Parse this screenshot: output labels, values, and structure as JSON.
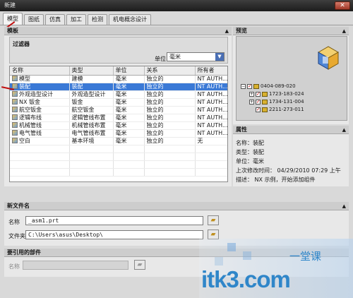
{
  "window": {
    "title": "新建",
    "close_label": "✕"
  },
  "tabs": [
    {
      "label": "模型",
      "active": true
    },
    {
      "label": "图纸",
      "active": false
    },
    {
      "label": "仿真",
      "active": false
    },
    {
      "label": "加工",
      "active": false
    },
    {
      "label": "检测",
      "active": false
    },
    {
      "label": "机电概念设计",
      "active": false
    }
  ],
  "templates": {
    "header": "模板",
    "filter": {
      "title": "过滤器",
      "unit_label": "单位",
      "unit_value": "毫米"
    },
    "columns": [
      "名称",
      "类型",
      "单位",
      "关系",
      "所有者"
    ],
    "rows": [
      {
        "name": "模型",
        "type": "建模",
        "unit": "毫米",
        "relation": "独立的",
        "owner": "NT AUTH...",
        "selected": false
      },
      {
        "name": "装配",
        "type": "装配",
        "unit": "毫米",
        "relation": "独立的",
        "owner": "NT AUTH...",
        "selected": true
      },
      {
        "name": "外观造型设计",
        "type": "外观造型设计",
        "unit": "毫米",
        "relation": "独立的",
        "owner": "NT AUTH...",
        "selected": false
      },
      {
        "name": "NX 钣金",
        "type": "钣金",
        "unit": "毫米",
        "relation": "独立的",
        "owner": "NT AUTH...",
        "selected": false
      },
      {
        "name": "航空钣金",
        "type": "航空钣金",
        "unit": "毫米",
        "relation": "独立的",
        "owner": "NT AUTH...",
        "selected": false
      },
      {
        "name": "逻辑布线",
        "type": "逻辑管线布置",
        "unit": "毫米",
        "relation": "独立的",
        "owner": "NT AUTH...",
        "selected": false
      },
      {
        "name": "机械管线",
        "type": "机械管线布置",
        "unit": "毫米",
        "relation": "独立的",
        "owner": "NT AUTH...",
        "selected": false
      },
      {
        "name": "电气管线",
        "type": "电气管线布置",
        "unit": "毫米",
        "relation": "独立的",
        "owner": "NT AUTH...",
        "selected": false
      },
      {
        "name": "空白",
        "type": "基本环境",
        "unit": "毫米",
        "relation": "独立的",
        "owner": "无",
        "selected": false
      }
    ]
  },
  "preview": {
    "header": "预览",
    "tree": [
      {
        "label": "0404-089-020",
        "expander": "−"
      },
      {
        "label": "1723-183-024",
        "expander": "+"
      },
      {
        "label": "1734-131-004",
        "expander": "+"
      },
      {
        "label": "2211-273-011",
        "expander": ""
      }
    ]
  },
  "properties": {
    "header": "属性",
    "name": "名称：装配",
    "type": "类型：装配",
    "unit": "单位：毫米",
    "modified": "上次修改时间： 04/29/2010 07:29 上午",
    "description": "描述： NX 示例，开始添加组件"
  },
  "new_file": {
    "header": "新文件名",
    "name_label": "名称",
    "name_value": "_asm1.prt",
    "folder_label": "文件夹",
    "folder_value": "C:\\Users\\asus\\Desktop\\"
  },
  "reference": {
    "header": "要引用的部件",
    "name_label": "名称",
    "name_value": ""
  },
  "watermark": {
    "main": "itk3.com",
    "sub": "一堂课"
  },
  "colors": {
    "selection": "#3a79d6",
    "accent_red": "#c01010",
    "watermark_blue": "#2f86c9"
  }
}
